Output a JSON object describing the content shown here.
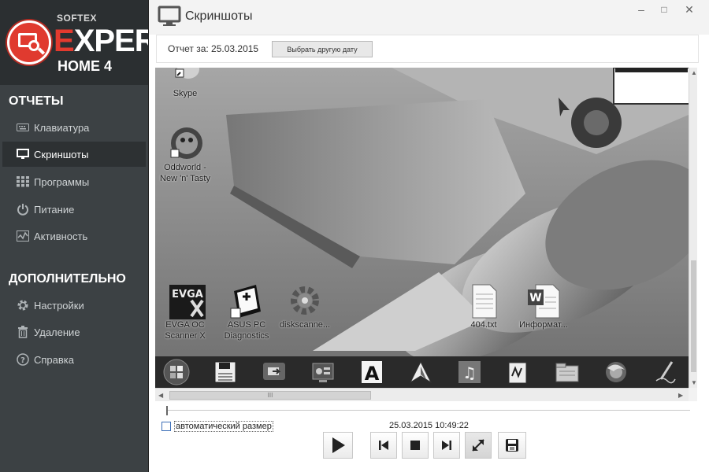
{
  "brand": {
    "company": "SOFTEX",
    "product_first_letter": "E",
    "product_rest": "XPERT",
    "edition": "HOME 4"
  },
  "sidebar": {
    "reports_title": "ОТЧЕТЫ",
    "reports": [
      {
        "label": "Клавиатура",
        "icon": "keyboard-icon"
      },
      {
        "label": "Скриншоты",
        "icon": "monitor-icon",
        "active": true
      },
      {
        "label": "Программы",
        "icon": "grid-icon"
      },
      {
        "label": "Питание",
        "icon": "power-icon"
      },
      {
        "label": "Активность",
        "icon": "activity-icon"
      }
    ],
    "extra_title": "ДОПОЛНИТЕЛЬНО",
    "extra": [
      {
        "label": "Настройки",
        "icon": "gear-icon"
      },
      {
        "label": "Удаление",
        "icon": "trash-icon"
      },
      {
        "label": "Справка",
        "icon": "help-icon"
      }
    ]
  },
  "window": {
    "title": "Скриншоты",
    "minimize": "–",
    "maximize": "□",
    "close": "✕"
  },
  "report": {
    "label": "Отчет за: 25.03.2015",
    "choose_date_button": "Выбрать другую дату"
  },
  "screenshot": {
    "desktop_icons": [
      {
        "label": "Skype"
      },
      {
        "label": "Oddworld -\nNew 'n' Tasty"
      },
      {
        "label": "EVGA OC\nScanner X"
      },
      {
        "label": "ASUS PC\nDiagnostics"
      },
      {
        "label": "diskscanne..."
      },
      {
        "label": "404.txt"
      },
      {
        "label": "Информат..."
      }
    ],
    "evga_text": "EVGA"
  },
  "controls": {
    "auto_size_label": "автоматический размер",
    "auto_size_checked": false,
    "timestamp": "25.03.2015 10:49:22",
    "scroll_grip": "III"
  },
  "colors": {
    "accent_red": "#e33a2e",
    "sidebar_bg": "#3c4144",
    "active_item_bg": "#2d3133"
  }
}
